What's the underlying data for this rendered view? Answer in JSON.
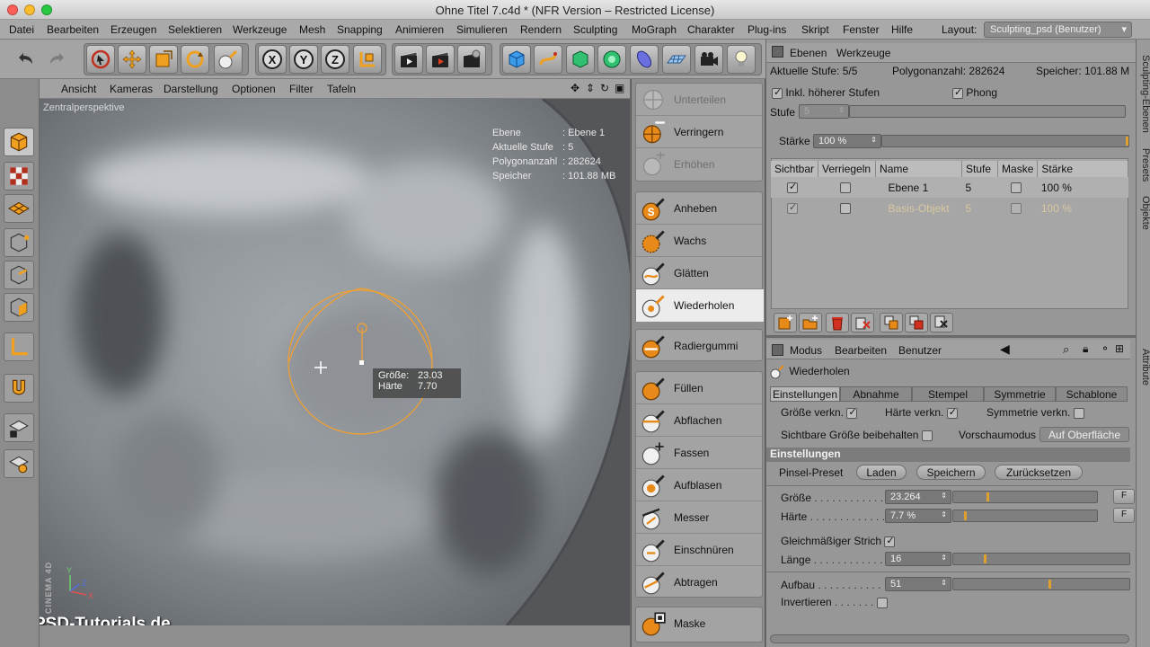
{
  "window": {
    "title": "Ohne Titel 7.c4d * (NFR Version – Restricted License)",
    "traffic_colors": [
      "#fc5f57",
      "#fdbc2e",
      "#28c840"
    ]
  },
  "menubar": {
    "items": [
      "Datei",
      "Bearbeiten",
      "Erzeugen",
      "Selektieren",
      "Werkzeuge",
      "Mesh",
      "Snapping",
      "Animieren",
      "Simulieren",
      "Rendern",
      "Sculpting",
      "MoGraph",
      "Charakter",
      "Plug-ins",
      "Skript",
      "Fenster",
      "Hilfe"
    ],
    "layout_label": "Layout:",
    "layout_value": "Sculpting_psd (Benutzer)"
  },
  "toolbar": {
    "icons": [
      "undo-icon",
      "redo-icon",
      "live-select-icon",
      "move-icon",
      "scale-icon",
      "rotate-icon",
      "brush-icon",
      "x-axis-icon",
      "y-axis-icon",
      "z-axis-icon",
      "coordinate-system-icon",
      "render-view-icon",
      "render-picture-viewer-icon",
      "render-settings-icon",
      "cube-icon",
      "spline-icon",
      "nurbs-icon",
      "array-icon",
      "deformer-icon",
      "floor-icon",
      "camera-icon",
      "light-icon"
    ]
  },
  "viewport": {
    "menu": [
      "Ansicht",
      "Kameras",
      "Darstellung",
      "Optionen",
      "Filter",
      "Tafeln"
    ],
    "label": "Zentralperspektive",
    "hud": [
      {
        "key": "Ebene",
        "value": "Ebene 1"
      },
      {
        "key": "Aktuelle Stufe",
        "value": "5"
      },
      {
        "key": "Polygonanzahl",
        "value": "282624"
      },
      {
        "key": "Speicher",
        "value": "101.88 MB"
      }
    ],
    "brush_hud": {
      "size_label": "Größe:",
      "size_value": "23.03",
      "hardness_label": "Härte",
      "hardness_value": "7.70"
    },
    "watermark": "PSD-Tutorials.de",
    "brand": "MAXON CINEMA 4D",
    "axis_labels": [
      "Y",
      "X",
      "Z"
    ]
  },
  "brushes": {
    "group1": [
      {
        "label": "Unterteilen",
        "icon": "subdivide-icon",
        "disabled": true
      },
      {
        "label": "Verringern",
        "icon": "decrease-icon",
        "disabled": false
      },
      {
        "label": "Erhöhen",
        "icon": "increase-icon",
        "disabled": true
      }
    ],
    "group2": [
      {
        "label": "Anheben",
        "icon": "pull-brush-icon",
        "active": false
      },
      {
        "label": "Wachs",
        "icon": "wax-brush-icon",
        "active": false
      },
      {
        "label": "Glätten",
        "icon": "smooth-brush-icon",
        "active": false
      },
      {
        "label": "Wiederholen",
        "icon": "repeat-brush-icon",
        "active": true
      }
    ],
    "group3": [
      {
        "label": "Radiergummi",
        "icon": "erase-brush-icon"
      }
    ],
    "group4": [
      {
        "label": "Füllen",
        "icon": "fill-brush-icon"
      },
      {
        "label": "Abflachen",
        "icon": "flatten-brush-icon"
      },
      {
        "label": "Fassen",
        "icon": "grab-brush-icon"
      },
      {
        "label": "Aufblasen",
        "icon": "inflate-brush-icon"
      },
      {
        "label": "Messer",
        "icon": "knife-brush-icon"
      },
      {
        "label": "Einschnüren",
        "icon": "pinch-brush-icon"
      },
      {
        "label": "Abtragen",
        "icon": "scrape-brush-icon"
      }
    ],
    "group5": [
      {
        "label": "Maske",
        "icon": "mask-brush-icon"
      }
    ]
  },
  "layers_panel": {
    "tabs": [
      "Ebenen",
      "Werkzeuge"
    ],
    "status": {
      "stufe_label": "Aktuelle Stufe: 5/5",
      "poly_label": "Polygonanzahl: 282624",
      "mem_label": "Speicher: 101.88 M"
    },
    "incl_higher": "Inkl. höherer Stufen",
    "phong": "Phong",
    "stufe_label": "Stufe",
    "stufe_value": "5",
    "staerke_label": "Stärke",
    "staerke_value": "100 %",
    "columns": [
      "Sichtbar",
      "Verriegeln",
      "Name",
      "Stufe",
      "Maske",
      "Stärke"
    ],
    "rows": [
      {
        "name": "Ebene 1",
        "stufe": "5",
        "staerke": "100 %",
        "dim": false
      },
      {
        "name": "Basis-Objekt",
        "stufe": "5",
        "staerke": "100 %",
        "dim": true
      }
    ]
  },
  "side_tabs": [
    "Sculpting-Ebenen",
    "Presets",
    "Objekte",
    "Attribute"
  ],
  "attributes": {
    "menu": [
      "Modus",
      "Bearbeiten",
      "Benutzer"
    ],
    "tool_name": "Wiederholen",
    "subtabs": [
      "Einstellungen",
      "Abnahme",
      "Stempel",
      "Symmetrie",
      "Schablone"
    ],
    "size_link": "Größe verkn.",
    "hard_link": "Härte verkn.",
    "sym_link": "Symmetrie verkn.",
    "keep_visible": "Sichtbare Größe beibehalten",
    "preview_label": "Vorschaumodus",
    "preview_value": "Auf Oberfläche",
    "section": "Einstellungen",
    "preset_label": "Pinsel-Preset",
    "buttons": [
      "Laden",
      "Speichern",
      "Zurücksetzen"
    ],
    "groesse_label": "Größe",
    "groesse_value": "23.264",
    "groesse_fraction": 0.23,
    "haerte_label": "Härte",
    "haerte_value": "7.7 %",
    "haerte_fraction": 0.077,
    "strich_label": "Gleichmäßiger Strich",
    "laenge_label": "Länge",
    "laenge_value": "16",
    "aufbau_label": "Aufbau",
    "aufbau_value": "51",
    "invert_label": "Invertieren"
  }
}
